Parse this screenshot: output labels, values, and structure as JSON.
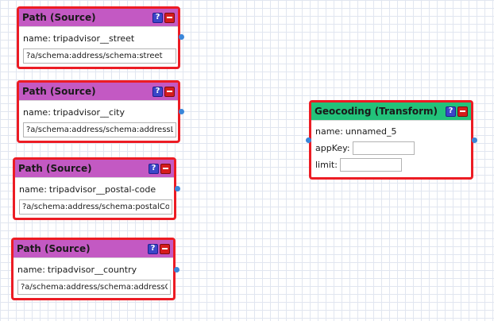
{
  "nodes": [
    {
      "title": "Path (Source)",
      "name_label": "name:",
      "name_value": "tripadvisor__street",
      "path_value": "?a/schema:address/schema:street"
    },
    {
      "title": "Path (Source)",
      "name_label": "name:",
      "name_value": "tripadvisor__city",
      "path_value": "?a/schema:address/schema:addressLocality"
    },
    {
      "title": "Path (Source)",
      "name_label": "name:",
      "name_value": "tripadvisor__postal-code",
      "path_value": "?a/schema:address/schema:postalCode"
    },
    {
      "title": "Path (Source)",
      "name_label": "name:",
      "name_value": "tripadvisor__country",
      "path_value": "?a/schema:address/schema:addressCountry"
    }
  ],
  "transform": {
    "title": "Geocoding (Transform)",
    "name_label": "name:",
    "name_value": "unnamed_5",
    "appkey_label": "appKey:",
    "appkey_value": "",
    "limit_label": "limit:",
    "limit_value": ""
  },
  "buttons": {
    "help_glyph": "?"
  },
  "colors": {
    "node_border": "#ec1c24",
    "source_header": "#c359c3",
    "transform_header": "#22c27a",
    "port": "#3a86d9",
    "help_button": "#3b46c8",
    "close_button": "#d61c1c"
  }
}
